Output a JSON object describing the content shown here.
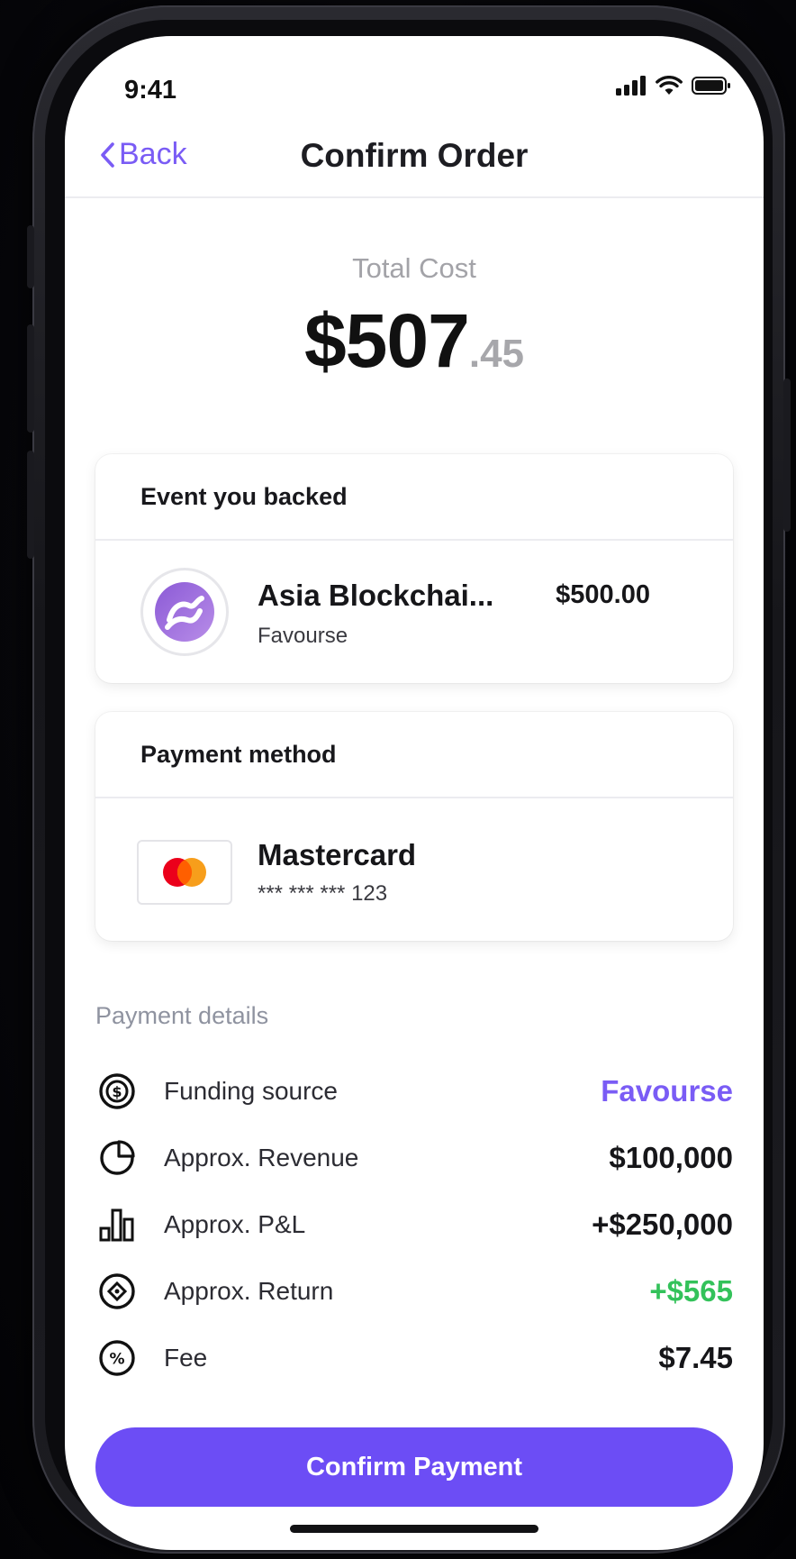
{
  "status_bar": {
    "time": "9:41"
  },
  "nav": {
    "back_label": "Back",
    "title": "Confirm Order"
  },
  "total": {
    "label": "Total Cost",
    "amount_main": "$507",
    "amount_cents": ".45"
  },
  "event_card": {
    "header": "Event you backed",
    "name": "Asia Blockchai...",
    "subtitle": "Favourse",
    "amount": "$500.00",
    "icon": "favourse-logo"
  },
  "payment_card": {
    "header": "Payment method",
    "name": "Mastercard",
    "number": "*** *** *** 123",
    "icon": "mastercard-logo"
  },
  "details": {
    "label": "Payment details",
    "rows": [
      {
        "icon": "dollar-circle-icon",
        "label": "Funding source",
        "value": "Favourse"
      },
      {
        "icon": "pie-chart-icon",
        "label": "Approx. Revenue",
        "value": "$100,000"
      },
      {
        "icon": "bar-chart-icon",
        "label": "Approx. P&L",
        "value": "+$250,000"
      },
      {
        "icon": "target-icon",
        "label": "Approx. Return",
        "value": "+$565"
      },
      {
        "icon": "percent-circle-icon",
        "label": "Fee",
        "value": "$7.45"
      }
    ]
  },
  "confirm_button": {
    "label": "Confirm Payment"
  },
  "colors": {
    "accent": "#6c4df5",
    "link": "#7a5cf5",
    "positive": "#33c25a",
    "mastercard_red": "#eb001b",
    "mastercard_orange": "#f79e1b"
  }
}
